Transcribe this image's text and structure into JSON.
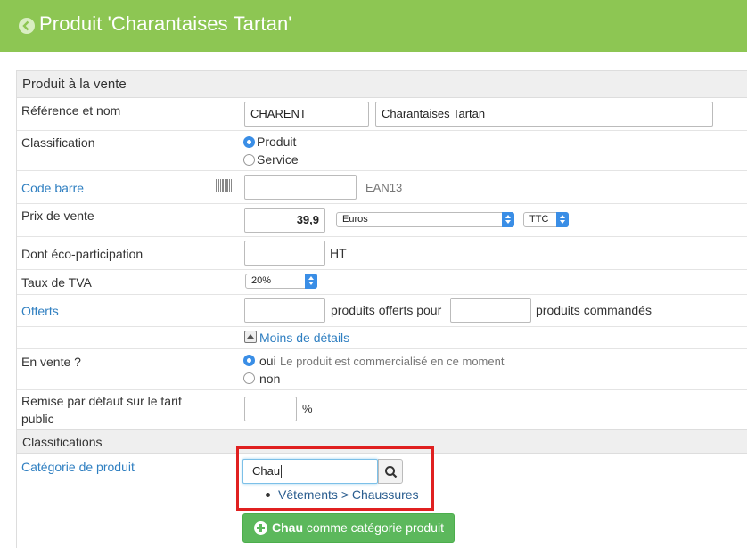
{
  "header": {
    "title": "Produit 'Charantaises Tartan'"
  },
  "sections": {
    "sale": "Produit à la vente",
    "classifications": "Classifications"
  },
  "reference": {
    "label": "Référence et nom",
    "code": "CHARENT",
    "name": "Charantaises Tartan"
  },
  "classification": {
    "label": "Classification",
    "options": [
      "Produit",
      "Service"
    ],
    "selected": "Produit"
  },
  "barcode": {
    "label": "Code barre",
    "value": "",
    "type": "EAN13"
  },
  "price": {
    "label": "Prix de vente",
    "value": "39,9",
    "currency": "Euros",
    "tax_mode": "TTC"
  },
  "eco": {
    "label": "Dont éco-participation",
    "value": "",
    "unit": "HT"
  },
  "vat": {
    "label": "Taux de TVA",
    "value": "20%"
  },
  "offers": {
    "label": "Offerts",
    "text1": "produits offerts pour",
    "text2": "produits commandés"
  },
  "less_details": "Moins de détails",
  "on_sale": {
    "label": "En vente ?",
    "yes": "oui",
    "yes_note": "Le produit est commercialisé en ce moment",
    "no": "non",
    "selected": "oui"
  },
  "discount": {
    "label": "Remise par défaut sur le tarif public",
    "value": "",
    "unit": "%"
  },
  "category": {
    "label": "Catégorie de produit",
    "query": "Chau",
    "suggestion": "Vêtements > Chaussures",
    "add_bold": "Chau",
    "add_rest": " comme catégorie produit"
  },
  "colors": {
    "topbar": "#8dc653",
    "link": "#2f7fc1",
    "accent": "#3a8ee6",
    "highlight": "#e02020",
    "button": "#5cb85c"
  },
  "icons": [
    "back-icon",
    "barcode-icon",
    "collapse-icon",
    "search-icon",
    "plus-circle-icon"
  ]
}
